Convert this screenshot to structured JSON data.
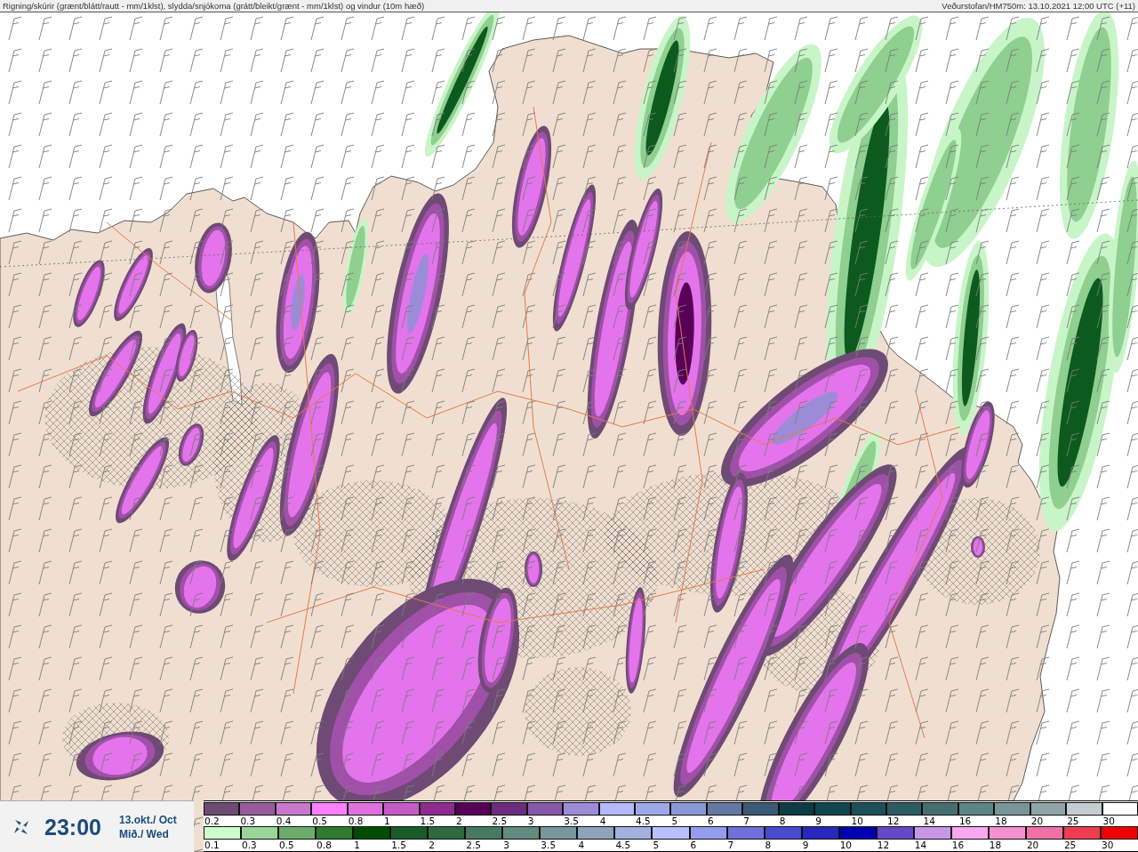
{
  "header": {
    "title": "Rigning/skúrir (grænt/blátt/rautt - mm/1klst), slydda/snjókoma (grátt/bleikt/grænt - mm/1klst) og vindur (10m hæð)",
    "run_info": "Veðurstofan/HM750m: 13.10.2021 12:00 UTC (+11)"
  },
  "time_panel": {
    "time": "23:00",
    "date": "13.okt./ Oct",
    "weekday": "Mið./ Wed"
  },
  "legend_rows": [
    {
      "steps": [
        {
          "label": "0.2",
          "color": "#6e4a75"
        },
        {
          "label": "0.3",
          "color": "#9a5a9e"
        },
        {
          "label": "0.4",
          "color": "#c878cc"
        },
        {
          "label": "0.5",
          "color": "#ff80ff"
        },
        {
          "label": "0.8",
          "color": "#e070e0"
        },
        {
          "label": "1",
          "color": "#c85ac8"
        },
        {
          "label": "1.5",
          "color": "#902a90"
        },
        {
          "label": "2",
          "color": "#580058"
        },
        {
          "label": "2.5",
          "color": "#6c2c80"
        },
        {
          "label": "3",
          "color": "#8858a8"
        },
        {
          "label": "3.5",
          "color": "#9c8cd8"
        },
        {
          "label": "4",
          "color": "#b4b8ff"
        },
        {
          "label": "4.5",
          "color": "#9ca8e8"
        },
        {
          "label": "5",
          "color": "#8a98d8"
        },
        {
          "label": "6",
          "color": "#6478a4"
        },
        {
          "label": "7",
          "color": "#3a5a76"
        },
        {
          "label": "8",
          "color": "#0c3c46"
        },
        {
          "label": "9",
          "color": "#12464e"
        },
        {
          "label": "10",
          "color": "#1c5058"
        },
        {
          "label": "12",
          "color": "#2c5c62"
        },
        {
          "label": "14",
          "color": "#466e70"
        },
        {
          "label": "16",
          "color": "#5e8486"
        },
        {
          "label": "18",
          "color": "#78969a"
        },
        {
          "label": "20",
          "color": "#8ea4a8"
        },
        {
          "label": "25",
          "color": "#c4ced2"
        },
        {
          "label": "30",
          "color": "#ffffff"
        }
      ]
    },
    {
      "steps": [
        {
          "label": "0.1",
          "color": "#ccffcc"
        },
        {
          "label": "0.3",
          "color": "#99d699"
        },
        {
          "label": "0.5",
          "color": "#6aac6a"
        },
        {
          "label": "0.8",
          "color": "#2e7a2e"
        },
        {
          "label": "1",
          "color": "#004c00"
        },
        {
          "label": "1.5",
          "color": "#1a5c28"
        },
        {
          "label": "2",
          "color": "#2c6a40"
        },
        {
          "label": "2.5",
          "color": "#487a62"
        },
        {
          "label": "3",
          "color": "#628c80"
        },
        {
          "label": "3.5",
          "color": "#78969e"
        },
        {
          "label": "4",
          "color": "#8ea4bc"
        },
        {
          "label": "4.5",
          "color": "#a4b0e0"
        },
        {
          "label": "5",
          "color": "#b8c0ff"
        },
        {
          "label": "6",
          "color": "#949cee"
        },
        {
          "label": "7",
          "color": "#7070dc"
        },
        {
          "label": "8",
          "color": "#4a4ad0"
        },
        {
          "label": "9",
          "color": "#2828c0"
        },
        {
          "label": "10",
          "color": "#0000b0"
        },
        {
          "label": "12",
          "color": "#6448c8"
        },
        {
          "label": "14",
          "color": "#c896e6"
        },
        {
          "label": "16",
          "color": "#f8a8f0"
        },
        {
          "label": "18",
          "color": "#f490d0"
        },
        {
          "label": "20",
          "color": "#f070a8"
        },
        {
          "label": "25",
          "color": "#f03c50"
        },
        {
          "label": "30",
          "color": "#f00000"
        }
      ]
    }
  ]
}
